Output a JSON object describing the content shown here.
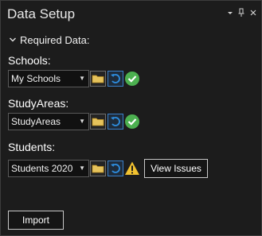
{
  "window": {
    "title": "Data Setup",
    "menu_glyph": "▾",
    "pin_glyph": "ⅎ",
    "close_glyph": "✕"
  },
  "section": {
    "label": "Required Data:",
    "expanded": true
  },
  "schools": {
    "label": "Schools:",
    "value": "My Schools",
    "status": "ok"
  },
  "study_areas": {
    "label": "StudyAreas:",
    "value": "StudyAreas",
    "status": "ok"
  },
  "students": {
    "label": "Students:",
    "value": "Students 2020",
    "status": "warning",
    "view_issues_label": "View Issues"
  },
  "actions": {
    "import_label": "Import"
  },
  "colors": {
    "ok": "#4cb050",
    "warning": "#f2c230",
    "folder": "#e6c35c",
    "undo": "#2e8ee0"
  }
}
